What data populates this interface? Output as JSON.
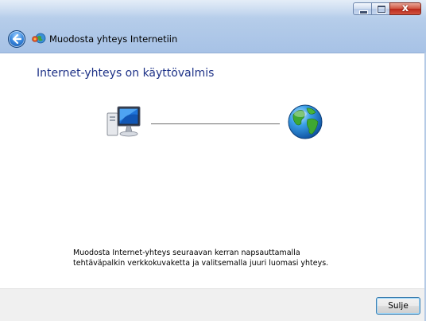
{
  "window": {
    "title": "Muodosta yhteys Internetiin",
    "caption_buttons": [
      "minimize",
      "maximize",
      "close"
    ],
    "close_glyph": "x"
  },
  "icons": {
    "back": "back-arrow-icon",
    "title": "network-globe-icon",
    "computer": "computer-icon",
    "internet": "globe-icon"
  },
  "page": {
    "heading": "Internet-yhteys on käyttövalmis",
    "info_line1": "Muodosta Internet-yhteys seuraavan kerran napsauttamalla",
    "info_line2": "tehtäväpalkin verkkokuvaketta ja valitsemalla juuri luomasi yhteys."
  },
  "footer": {
    "close_label": "Sulje"
  },
  "colors": {
    "heading": "#1e3287",
    "titlebar": "#b3cbe9",
    "footer": "#f0f0f0"
  }
}
